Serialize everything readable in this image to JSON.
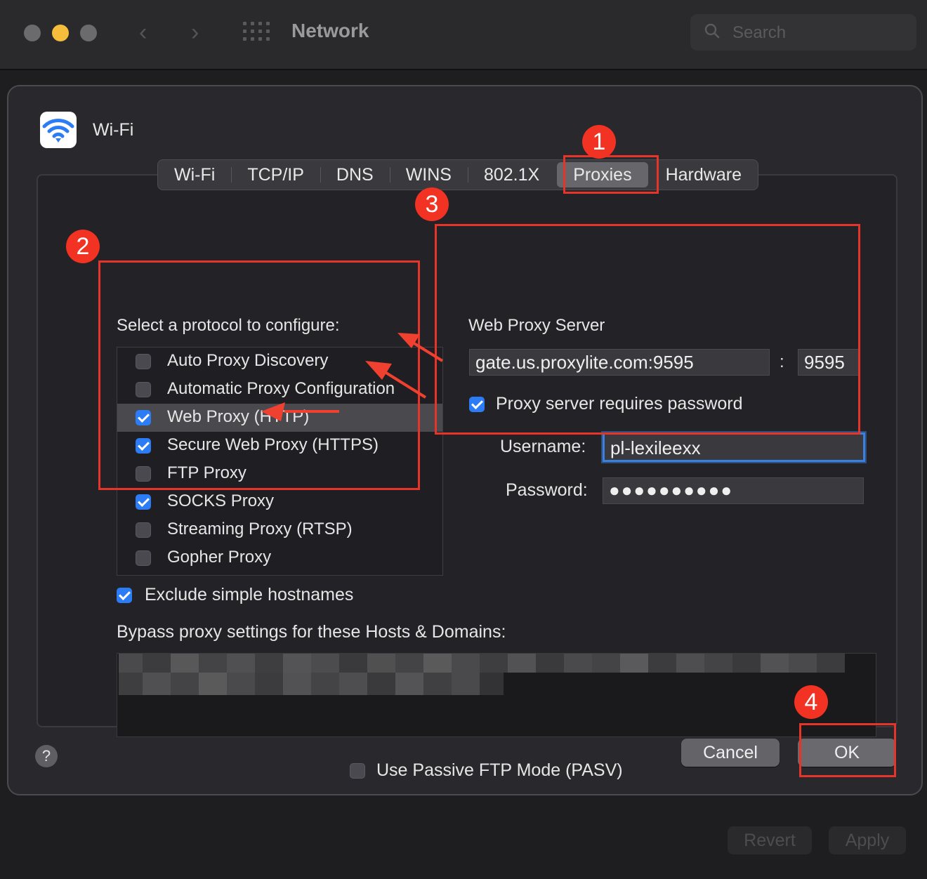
{
  "window": {
    "title": "Network",
    "search_placeholder": "Search",
    "revert_label": "Revert",
    "apply_label": "Apply"
  },
  "sheet": {
    "title": "Wi-Fi",
    "tabs": [
      {
        "label": "Wi-Fi",
        "active": false
      },
      {
        "label": "TCP/IP",
        "active": false
      },
      {
        "label": "DNS",
        "active": false
      },
      {
        "label": "WINS",
        "active": false
      },
      {
        "label": "802.1X",
        "active": false
      },
      {
        "label": "Proxies",
        "active": true
      },
      {
        "label": "Hardware",
        "active": false
      }
    ],
    "protocol_label": "Select a protocol to configure:",
    "protocols": [
      {
        "label": "Auto Proxy Discovery",
        "checked": false
      },
      {
        "label": "Automatic Proxy Configuration",
        "checked": false
      },
      {
        "label": "Web Proxy (HTTP)",
        "checked": true,
        "selected": true
      },
      {
        "label": "Secure Web Proxy (HTTPS)",
        "checked": true
      },
      {
        "label": "FTP Proxy",
        "checked": false
      },
      {
        "label": "SOCKS Proxy",
        "checked": true
      },
      {
        "label": "Streaming Proxy (RTSP)",
        "checked": false
      },
      {
        "label": "Gopher Proxy",
        "checked": false
      }
    ],
    "web_proxy": {
      "title": "Web Proxy Server",
      "server": "gate.us.proxylite.com:9595",
      "colon": ":",
      "port": "9595",
      "requires_password_label": "Proxy server requires password",
      "requires_password": true,
      "username_label": "Username:",
      "username": "pl-lexileexx",
      "password_label": "Password:",
      "password_mask": "●●●●●●●●●●"
    },
    "exclude_simple_label": "Exclude simple hostnames",
    "exclude_simple": true,
    "bypass_label": "Bypass proxy settings for these Hosts & Domains:",
    "pasv_label": "Use Passive FTP Mode (PASV)",
    "pasv": false,
    "help_label": "?",
    "cancel_label": "Cancel",
    "ok_label": "OK"
  },
  "annotations": {
    "badges": [
      "1",
      "2",
      "3",
      "4"
    ],
    "color": "#e5352a"
  },
  "colors": {
    "accent": "#2c7cf6",
    "focus_ring": "#3d7fd9",
    "wifi_icon": "#2c7cf6"
  }
}
